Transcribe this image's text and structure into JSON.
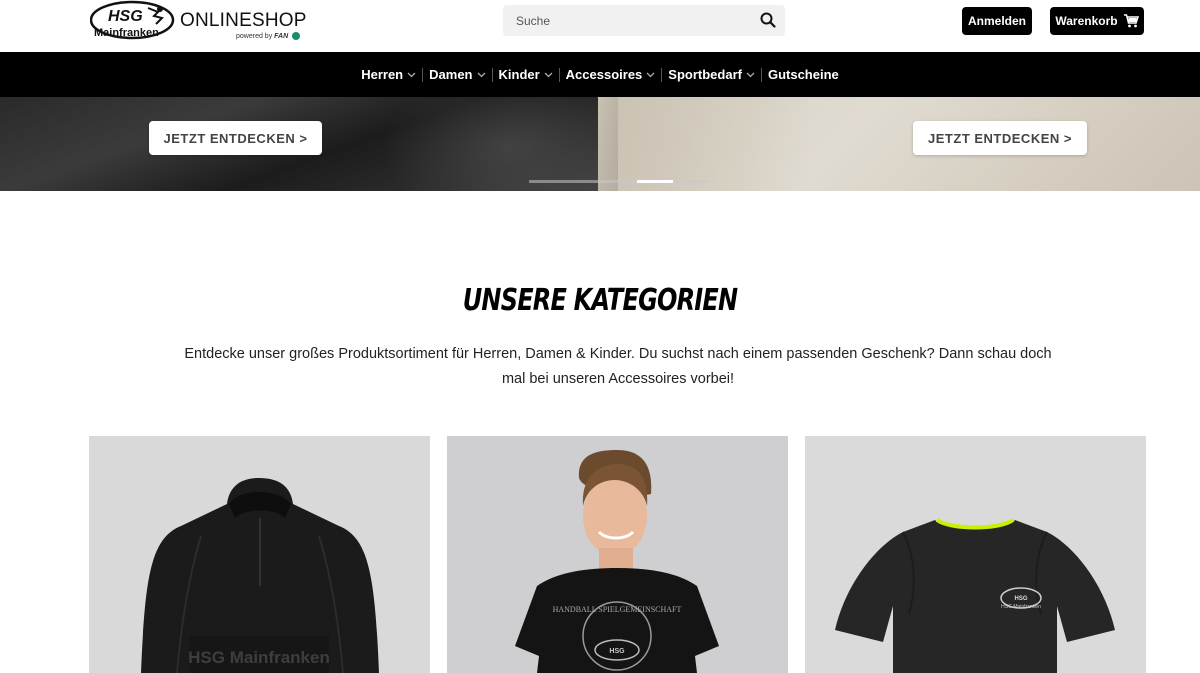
{
  "header": {
    "logo": {
      "brand": "HSG",
      "brand_sub": "Mainfranken",
      "shop_label": "ONLINESHOP",
      "powered_by": "powered by",
      "powered_brand": "FAN"
    },
    "search": {
      "placeholder": "Suche"
    },
    "login_label": "Anmelden",
    "cart_label": "Warenkorb"
  },
  "nav": {
    "items": [
      {
        "label": "Herren",
        "has_dropdown": true
      },
      {
        "label": "Damen",
        "has_dropdown": true
      },
      {
        "label": "Kinder",
        "has_dropdown": true
      },
      {
        "label": "Accessoires",
        "has_dropdown": true
      },
      {
        "label": "Sportbedarf",
        "has_dropdown": true
      },
      {
        "label": "Gutscheine",
        "has_dropdown": false
      }
    ]
  },
  "hero": {
    "left_button": "JETZT ENTDECKEN >",
    "right_button": "JETZT ENTDECKEN >",
    "slider": {
      "count": 5,
      "active_index": 3
    }
  },
  "categories": {
    "title": "UNSERE KATEGORIEN",
    "description": "Entdecke unser großes Produktsortiment für Herren, Damen & Kinder. Du suchst nach einem passenden Geschenk? Dann schau doch mal bei unseren Accessoires vorbei!",
    "cards": [
      {
        "print_text": "HSG Mainfranken",
        "image": "black-anorak"
      },
      {
        "print_text": "HANDBALL SPIELGEMEINSCHAFT",
        "image": "woman-black-tshirt"
      },
      {
        "print_text": "HSG Mainfranken",
        "image": "black-sport-shirt"
      }
    ]
  },
  "colors": {
    "nav_bg": "#000000",
    "button_dark": "#000000",
    "accent_neon": "#c8f000",
    "search_bg": "#f1f1f1"
  }
}
